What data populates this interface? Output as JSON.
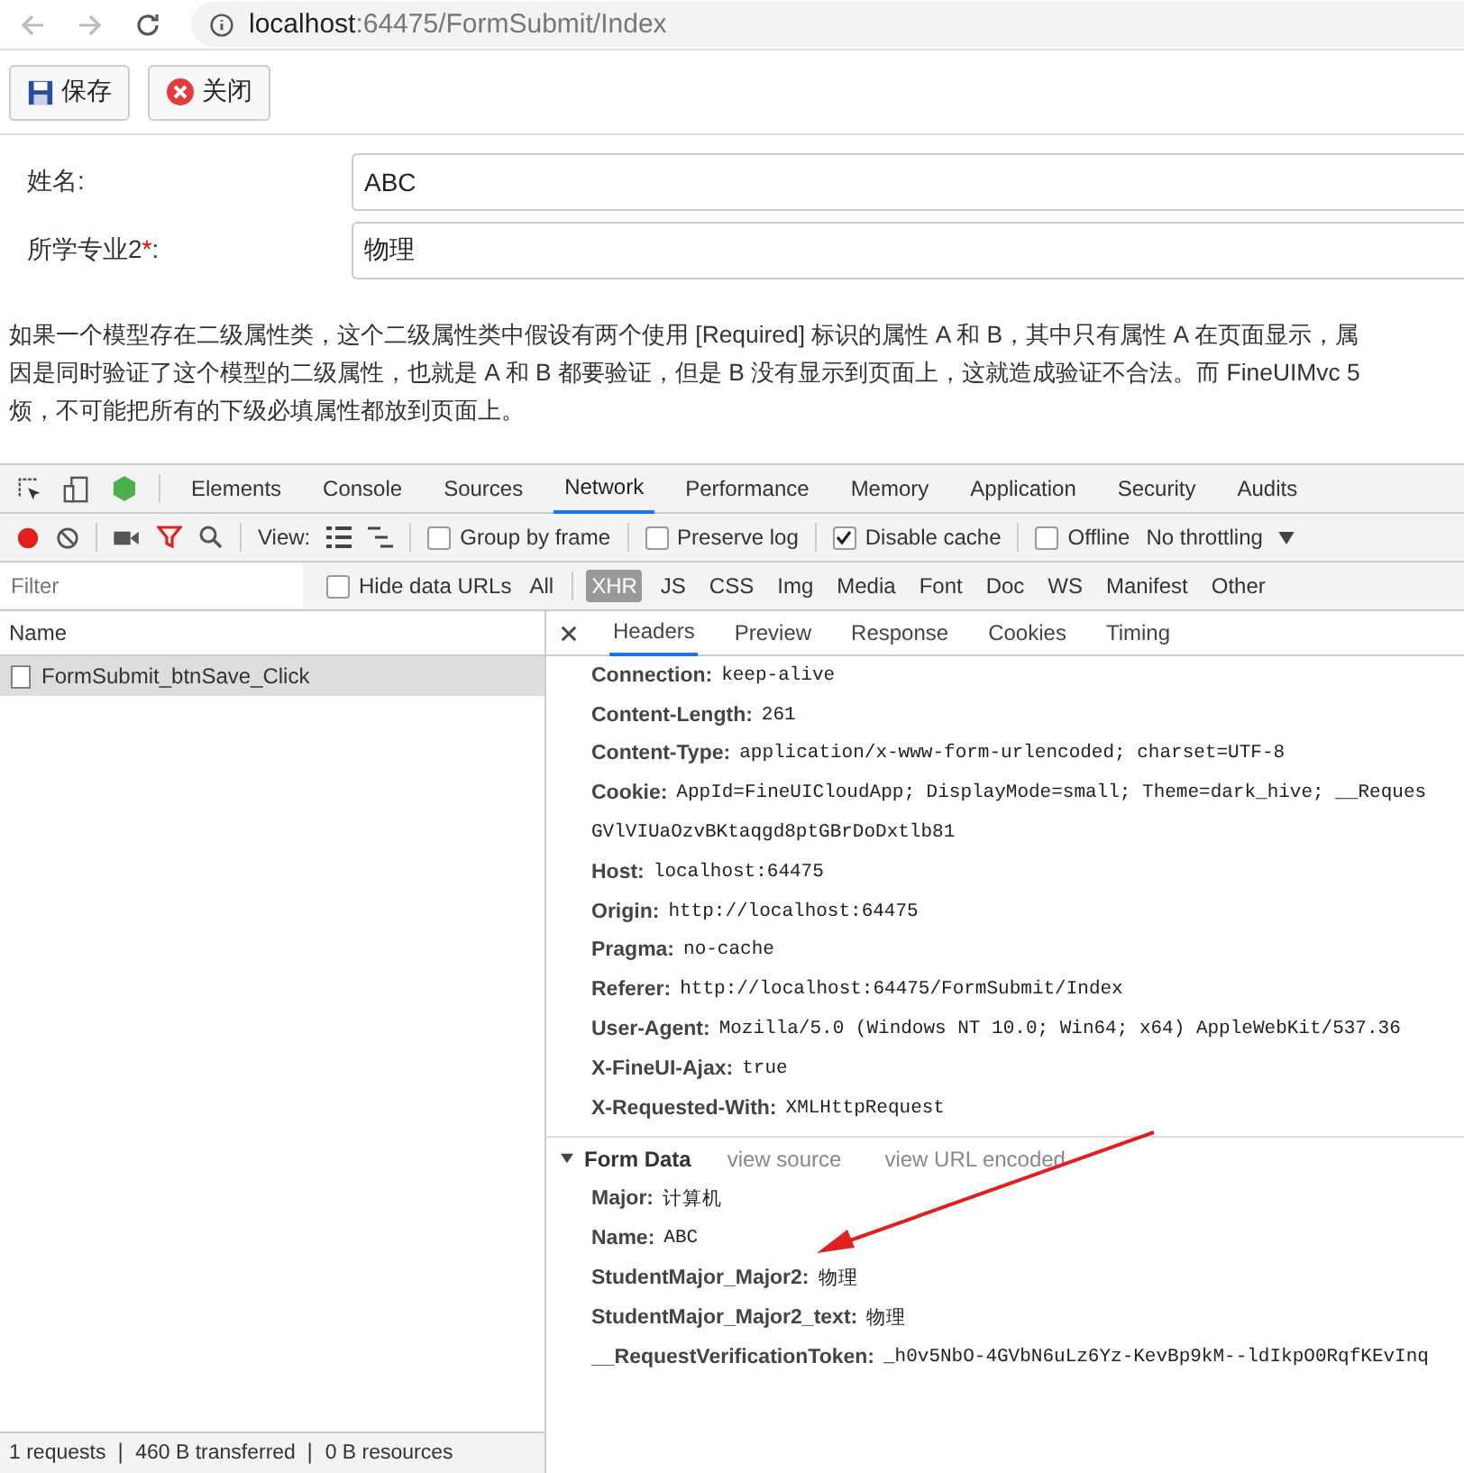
{
  "address_bar": {
    "url_host": "localhost",
    "url_rest": ":64475/FormSubmit/Index"
  },
  "toolbar": {
    "buttons": [
      {
        "kind": "save",
        "label": "保存"
      },
      {
        "kind": "close",
        "label": "关闭"
      }
    ]
  },
  "form": {
    "fields": [
      {
        "label": "姓名:",
        "value": "ABC"
      },
      {
        "label": "所学专业2",
        "required_mark": "*",
        "suffix": ":",
        "value": "物理"
      }
    ]
  },
  "paragraph_lines": [
    "如果一个模型存在二级属性类，这个二级属性类中假设有两个使用 [Required] 标识的属性 A 和 B，其中只有属性 A 在页面显示，属",
    "因是同时验证了这个模型的二级属性，也就是 A 和 B 都要验证，但是 B 没有显示到页面上，这就造成验证不合法。而 FineUIMvc 5",
    "烦，不可能把所有的下级必填属性都放到页面上。"
  ],
  "devtools": {
    "tabs": [
      {
        "label": "Elements",
        "selected": false
      },
      {
        "label": "Console",
        "selected": false
      },
      {
        "label": "Sources",
        "selected": false
      },
      {
        "label": "Network",
        "selected": true
      },
      {
        "label": "Performance",
        "selected": false
      },
      {
        "label": "Memory",
        "selected": false
      },
      {
        "label": "Application",
        "selected": false
      },
      {
        "label": "Security",
        "selected": false
      },
      {
        "label": "Audits",
        "selected": false
      }
    ],
    "view_label": "View:",
    "options": [
      {
        "label": "Group by frame",
        "checked": false
      },
      {
        "label": "Preserve log",
        "checked": false
      },
      {
        "label": "Disable cache",
        "checked": true
      },
      {
        "label": "Offline",
        "checked": false
      }
    ],
    "throttling": "No throttling",
    "filter": {
      "placeholder": "Filter",
      "hide_data_urls": {
        "label": "Hide data URLs",
        "checked": false
      },
      "types": [
        {
          "label": "All",
          "selected": false
        },
        {
          "label": "XHR",
          "selected": true
        },
        {
          "label": "JS",
          "selected": false
        },
        {
          "label": "CSS",
          "selected": false
        },
        {
          "label": "Img",
          "selected": false
        },
        {
          "label": "Media",
          "selected": false
        },
        {
          "label": "Font",
          "selected": false
        },
        {
          "label": "Doc",
          "selected": false
        },
        {
          "label": "WS",
          "selected": false
        },
        {
          "label": "Manifest",
          "selected": false
        },
        {
          "label": "Other",
          "selected": false
        }
      ]
    },
    "requests": {
      "column": "Name",
      "rows": [
        {
          "name": "FormSubmit_btnSave_Click",
          "selected": true
        }
      ]
    },
    "status": "1 requests ❘ 460 B transferred ❘ 0 B resources",
    "detail_tabs": [
      {
        "label": "Headers",
        "selected": true
      },
      {
        "label": "Preview",
        "selected": false
      },
      {
        "label": "Response",
        "selected": false
      },
      {
        "label": "Cookies",
        "selected": false
      },
      {
        "label": "Timing",
        "selected": false
      }
    ],
    "headers": [
      {
        "name": "Connection:",
        "value": "keep-alive"
      },
      {
        "name": "Content-Length:",
        "value": "261"
      },
      {
        "name": "Content-Type:",
        "value": "application/x-www-form-urlencoded; charset=UTF-8"
      },
      {
        "name": "Cookie:",
        "value": "AppId=FineUICloudApp; DisplayMode=small; Theme=dark_hive; __Reques"
      },
      {
        "value": "GVlVIUaOzvBKtaqgd8ptGBrDoDxtlb81"
      },
      {
        "name": "Host:",
        "value": "localhost:64475"
      },
      {
        "name": "Origin:",
        "value": "http://localhost:64475"
      },
      {
        "name": "Pragma:",
        "value": "no-cache"
      },
      {
        "name": "Referer:",
        "value": "http://localhost:64475/FormSubmit/Index"
      },
      {
        "name": "User-Agent:",
        "value": "Mozilla/5.0 (Windows NT 10.0; Win64; x64) AppleWebKit/537.36"
      },
      {
        "name": "X-FineUI-Ajax:",
        "value": "true"
      },
      {
        "name": "X-Requested-With:",
        "value": "XMLHttpRequest"
      }
    ],
    "form_data": {
      "title": "Form Data",
      "expanded": true,
      "links": [
        "view source",
        "view URL encoded"
      ],
      "items": [
        {
          "name": "Major:",
          "value": "计算机"
        },
        {
          "name": "Name:",
          "value": "ABC"
        },
        {
          "name": "StudentMajor_Major2:",
          "value": "物理"
        },
        {
          "name": "StudentMajor_Major2_text:",
          "value": "物理"
        },
        {
          "name": "__RequestVerificationToken:",
          "value": "_h0v5NbO-4GVbN6uLz6Yz-KevBp9kM--ldIkpO0RqfKEvInq"
        }
      ]
    }
  }
}
